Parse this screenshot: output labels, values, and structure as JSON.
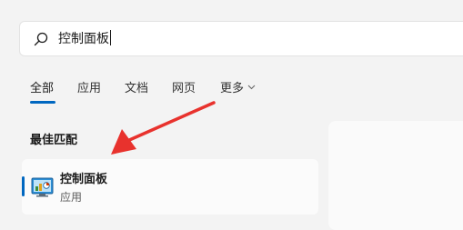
{
  "search": {
    "query": "控制面板"
  },
  "tabs": [
    {
      "label": "全部"
    },
    {
      "label": "应用"
    },
    {
      "label": "文档"
    },
    {
      "label": "网页"
    },
    {
      "label": "更多"
    }
  ],
  "best_match": {
    "title": "最佳匹配",
    "result": {
      "name": "控制面板",
      "type": "应用"
    }
  },
  "colors": {
    "accent": "#0067c0",
    "arrow": "#e8322d"
  }
}
